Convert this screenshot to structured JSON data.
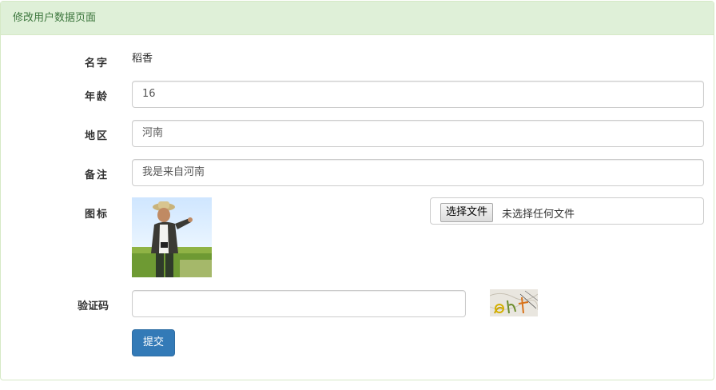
{
  "panel": {
    "title": "修改用户数据页面"
  },
  "form": {
    "name_label": "名字",
    "name_value": "稻香",
    "age_label": "年龄",
    "age_value": "16",
    "region_label": "地区",
    "region_value": "河南",
    "note_label": "备注",
    "note_value": "我是来自河南",
    "icon_label": "图标",
    "file_button": "选择文件",
    "file_status": "未选择任何文件",
    "captcha_label": "验证码",
    "captcha_value": "",
    "submit_label": "提交"
  },
  "colors": {
    "heading_bg": "#dff0d8",
    "heading_text": "#3c763d",
    "primary": "#337ab7"
  }
}
